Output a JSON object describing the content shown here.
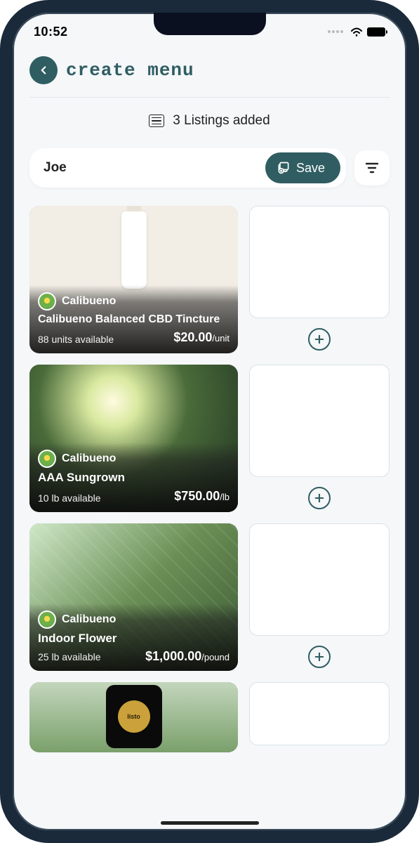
{
  "status": {
    "time": "10:52"
  },
  "header": {
    "title": "create menu"
  },
  "listings_summary": {
    "text": "3 Listings added"
  },
  "name_bar": {
    "value": "Joe",
    "save_label": "Save"
  },
  "products": [
    {
      "brand": "Calibueno",
      "title": "Calibueno Balanced CBD Tincture",
      "availability": "88 units available",
      "price": "$20.00",
      "per": "/unit"
    },
    {
      "brand": "Calibueno",
      "title": "AAA Sungrown",
      "availability": "10 lb available",
      "price": "$750.00",
      "per": "/lb"
    },
    {
      "brand": "Calibueno",
      "title": "Indoor Flower",
      "availability": "25 lb available",
      "price": "$1,000.00",
      "per": "/pound"
    }
  ],
  "listo_badge": "listo",
  "colors": {
    "accent": "#2f5d62"
  }
}
